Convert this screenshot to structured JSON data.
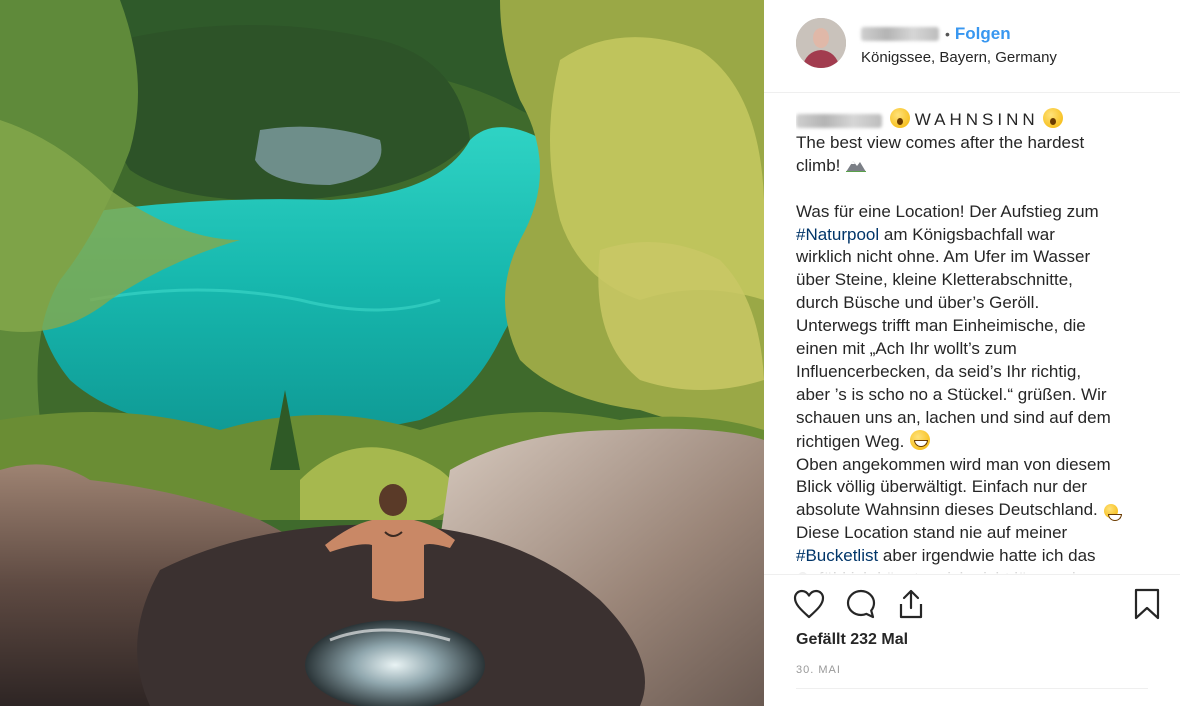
{
  "post": {
    "username_hidden": true,
    "follow_separator": "•",
    "follow_label": "Folgen",
    "location": "Königssee, Bayern, Germany",
    "caption": {
      "title": "WAHNSINN",
      "lines": [
        "The best view comes after the hardest",
        "climb!"
      ],
      "paragraph_lines": [
        {
          "pre": "Was für eine Location! Der Aufstieg zum",
          "tag": "",
          "post": ""
        },
        {
          "pre": "",
          "tag": "#Naturpool",
          "post": " am Königsbachfall war"
        },
        {
          "pre": "wirklich nicht ohne. Am Ufer im Wasser",
          "tag": "",
          "post": ""
        },
        {
          "pre": "über Steine, kleine Kletterabschnitte,",
          "tag": "",
          "post": ""
        },
        {
          "pre": "durch Büsche und über’s Geröll.",
          "tag": "",
          "post": ""
        },
        {
          "pre": "Unterwegs trifft man Einheimische, die",
          "tag": "",
          "post": ""
        },
        {
          "pre": "einen mit „Ach Ihr wollt’s zum",
          "tag": "",
          "post": ""
        },
        {
          "pre": "Influencerbecken, da seid’s Ihr richtig,",
          "tag": "",
          "post": ""
        },
        {
          "pre": "aber ’s is scho no a Stückel.“ grüßen. Wir",
          "tag": "",
          "post": ""
        },
        {
          "pre": "schauen uns an, lachen und sind auf dem",
          "tag": "",
          "post": ""
        },
        {
          "pre": "richtigen Weg.",
          "tag": "",
          "post": ""
        },
        {
          "pre": "Oben angekommen wird man von diesem",
          "tag": "",
          "post": ""
        },
        {
          "pre": "Blick völlig überwältigt. Einfach nur der",
          "tag": "",
          "post": ""
        },
        {
          "pre": "absolute Wahnsinn dieses Deutschland.",
          "tag": "",
          "post": ""
        },
        {
          "pre": "Diese Location stand nie auf meiner",
          "tag": "",
          "post": ""
        },
        {
          "pre": "",
          "tag": "#Bucketlist",
          "post": " aber irgendwie hatte ich das"
        },
        {
          "pre": "Gefühl ich könnte mich nicht länger davor",
          "tag": "",
          "post": ""
        }
      ]
    },
    "likes": "Gefällt 232 Mal",
    "date": "30. MAI"
  },
  "icons": {
    "like": "heart-icon",
    "comment": "comment-icon",
    "share": "share-icon",
    "save": "bookmark-icon"
  }
}
